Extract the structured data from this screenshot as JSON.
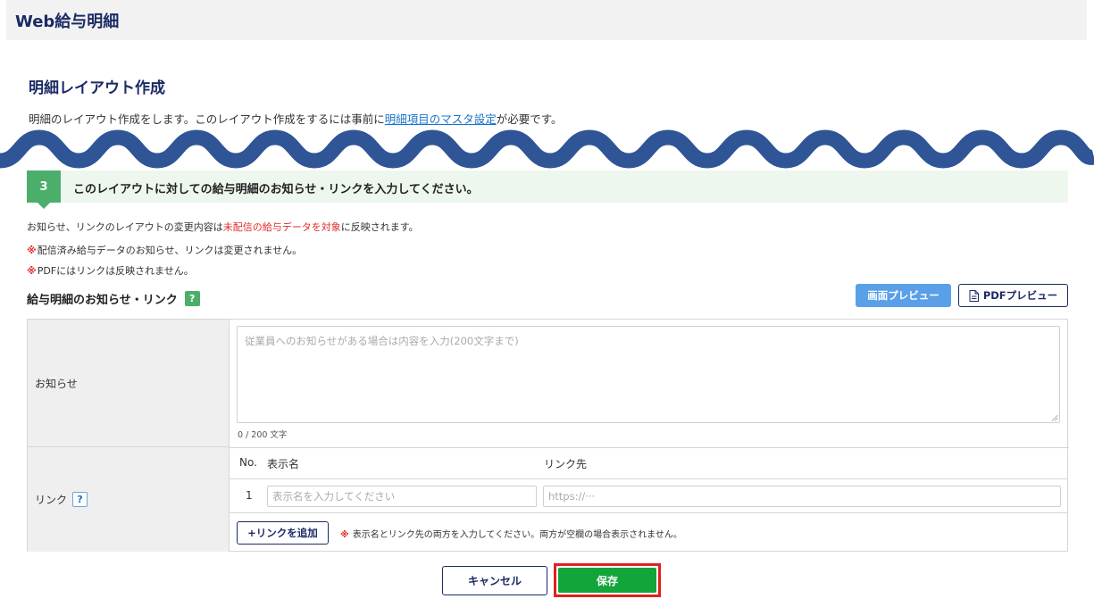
{
  "app": {
    "title": "Web給与明細"
  },
  "page": {
    "title": "明細レイアウト作成",
    "desc_before": "明細のレイアウト作成をします。このレイアウト作成をするには事前に",
    "desc_link": "明細項目のマスタ設定",
    "desc_after": "が必要です。"
  },
  "step": {
    "number": "3",
    "text": "このレイアウトに対しての給与明細のお知らせ・リンクを入力してください。"
  },
  "notes": {
    "line1_before": "お知らせ、リンクのレイアウトの変更内容は",
    "line1_red": "未配信の給与データを対象",
    "line1_after": "に反映されます。",
    "mark": "※",
    "line2": "配信済み給与データのお知らせ、リンクは変更されません。",
    "line3": "PDFにはリンクは反映されません。"
  },
  "section": {
    "label": "給与明細のお知らせ・リンク",
    "help_green": "?",
    "preview_label": "画面プレビュー",
    "pdf_label": "PDFプレビュー"
  },
  "notice": {
    "label": "お知らせ",
    "value": "",
    "placeholder": "従業員へのお知らせがある場合は内容を入力(200文字まで)",
    "char_count": "0 / 200 文字"
  },
  "links": {
    "label": "リンク",
    "help": "?",
    "col_no": "No.",
    "col_name": "表示名",
    "col_url": "リンク先",
    "rows": [
      {
        "no": "1",
        "name": "",
        "name_placeholder": "表示名を入力してください",
        "url": "",
        "url_placeholder": "https://···"
      }
    ],
    "add_label": "+リンクを追加",
    "add_note_mark": "※",
    "add_note": "表示名とリンク先の両方を入力してください。両方が空欄の場合表示されません。"
  },
  "actions": {
    "cancel_label": "キャンセル",
    "save_label": "保存"
  },
  "colors": {
    "brand": "#1b2a64",
    "accent_green": "#4cae6b",
    "save_green": "#12a53a",
    "alert_red": "#e02020",
    "wave": "#2f5597"
  }
}
